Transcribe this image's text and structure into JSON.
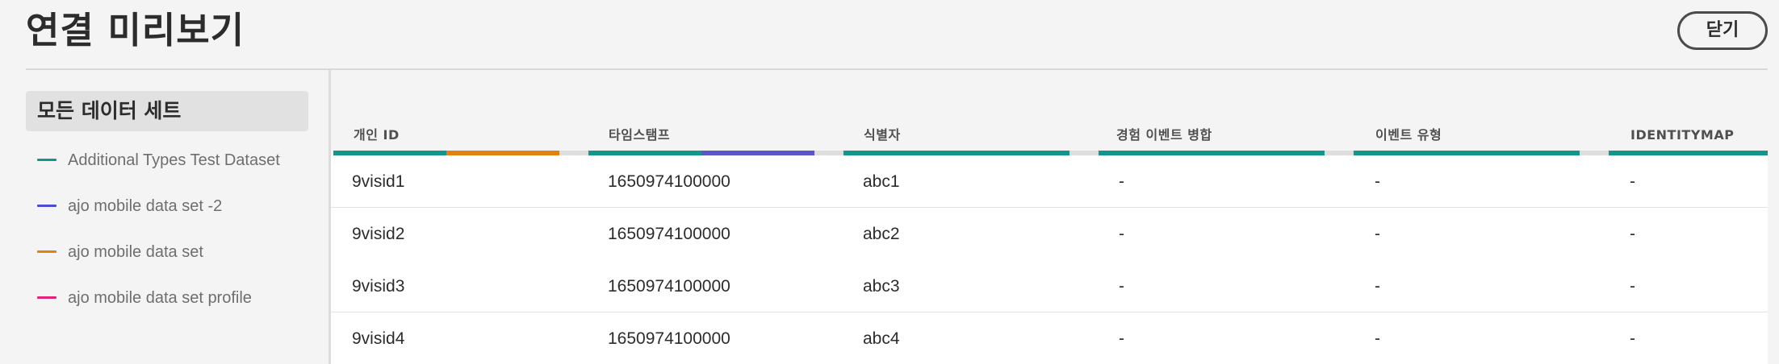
{
  "header": {
    "title": "연결 미리보기",
    "close_label": "닫기"
  },
  "sidebar": {
    "heading": "모든 데이터 세트",
    "datasets": [
      {
        "label": "Additional Types Test Dataset",
        "color": "#12968c"
      },
      {
        "label": "ajo mobile data set -2",
        "color": "#4b4bd3"
      },
      {
        "label": "ajo mobile data set",
        "color": "#e0820f"
      },
      {
        "label": "ajo mobile data set profile",
        "color": "#e2237a"
      }
    ]
  },
  "table": {
    "columns": [
      "개인 ID",
      "타임스탬프",
      "식별자",
      "경험 이벤트 병합",
      "이벤트 유형",
      "IDENTITYMAP"
    ],
    "colors": {
      "teal": "#12968c",
      "orange": "#e0820f",
      "purple": "#5a55c8",
      "gray": "#dedede"
    },
    "rows": [
      [
        "9visid1",
        "1650974100000",
        "abc1",
        "-",
        "-",
        "-"
      ],
      [
        "9visid2",
        "1650974100000",
        "abc2",
        "-",
        "-",
        "-"
      ],
      [
        "9visid3",
        "1650974100000",
        "abc3",
        "-",
        "-",
        "-"
      ],
      [
        "9visid4",
        "1650974100000",
        "abc4",
        "-",
        "-",
        "-"
      ]
    ]
  }
}
